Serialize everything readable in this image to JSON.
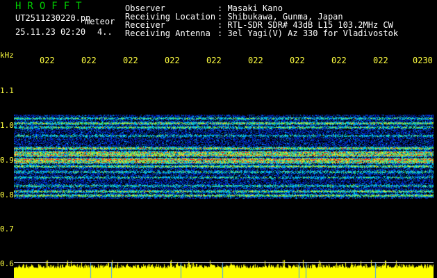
{
  "header": {
    "title": "HROFFT",
    "filename": "UT2511230220.pn",
    "mode": "meteor",
    "datetime": "25.11.23 02:20",
    "count": "4.."
  },
  "info": [
    {
      "label": "Observer",
      "value": ": Masaki Kano"
    },
    {
      "label": "Receiving Location",
      "value": ": Shibukawa, Gunma, Japan"
    },
    {
      "label": "Receiver",
      "value": ": RTL-SDR SDR# 43dB L15 103.2MHz CW"
    },
    {
      "label": "Receiving Antenna",
      "value": ": 3el Yagi(V) Az 330 for Vladivostok"
    }
  ],
  "axis": {
    "unit": "kHz",
    "yticks": [
      "1.1",
      "1.0",
      "0.9",
      "0.8",
      "0.7",
      "0.6"
    ],
    "xticks": [
      "022",
      "022",
      "022",
      "022",
      "022",
      "022",
      "022",
      "022",
      "022",
      "0230"
    ]
  },
  "colors": {
    "background": "#000000",
    "title": "#00d000",
    "tick": "#ffff40",
    "noise": "#1a3cff",
    "signal": "#ff2020",
    "power": "#ffff00"
  }
}
